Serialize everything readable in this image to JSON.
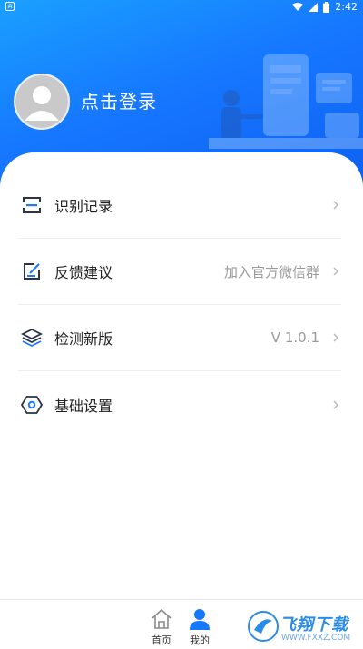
{
  "status_bar": {
    "time": "2:42",
    "left_indicator": "A"
  },
  "header": {
    "login_label": "点击登录"
  },
  "menu": {
    "items": [
      {
        "label": "识别记录",
        "value": "",
        "icon": "scan-record-icon"
      },
      {
        "label": "反馈建议",
        "value": "加入官方微信群",
        "icon": "feedback-edit-icon"
      },
      {
        "label": "检测新版",
        "value": "V 1.0.1",
        "icon": "layers-icon"
      },
      {
        "label": "基础设置",
        "value": "",
        "icon": "settings-hexagon-icon"
      }
    ]
  },
  "tabbar": {
    "home_label": "首页",
    "mine_label": "我的"
  },
  "watermark": {
    "main": "飞翔下载",
    "sub": "WWW.FXXZ.COM"
  },
  "colors": {
    "accent": "#1677ff",
    "header_top": "#1aa0ff",
    "icon_dark": "#2b3546",
    "icon_blue": "#1e78ff"
  }
}
